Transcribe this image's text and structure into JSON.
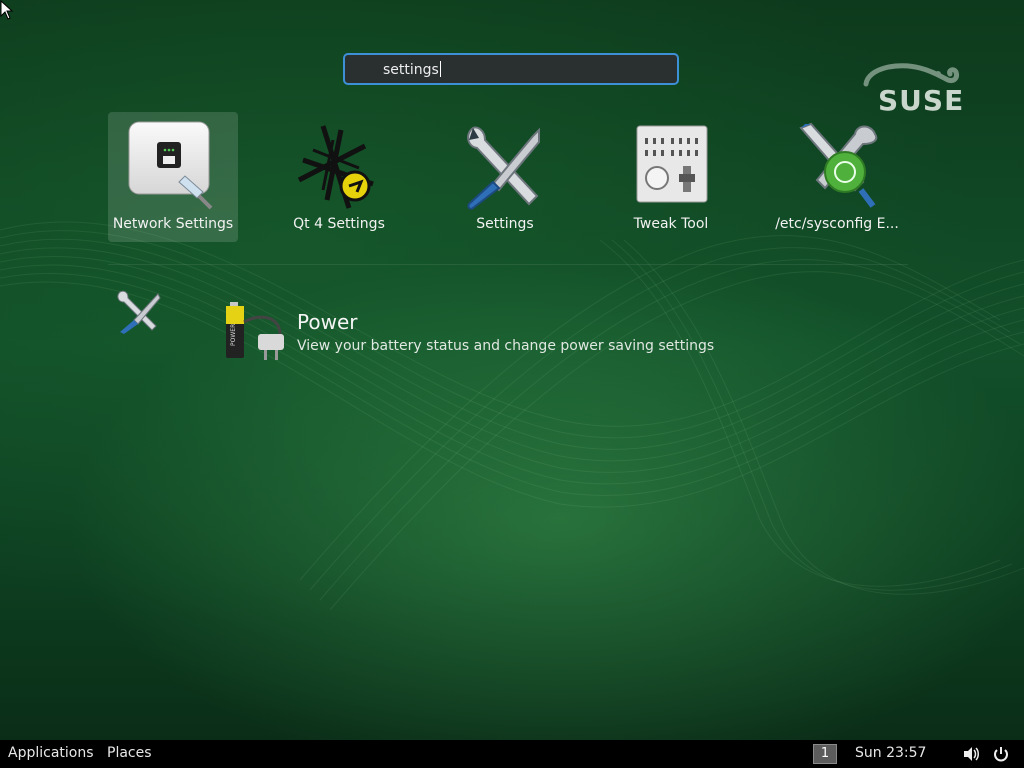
{
  "desktop": {
    "brand_logo": "SUSE",
    "search": {
      "value": "settings"
    },
    "apps": [
      {
        "label": "Network Settings",
        "icon": "network-settings-icon",
        "selected": true
      },
      {
        "label": "Qt 4 Settings",
        "icon": "qt4-settings-icon"
      },
      {
        "label": "Settings",
        "icon": "settings-tools-icon"
      },
      {
        "label": "Tweak Tool",
        "icon": "tweak-tool-icon"
      },
      {
        "label": "/etc/sysconfig E...",
        "icon": "sysconfig-editor-icon"
      }
    ],
    "search_result": {
      "provider_icon": "settings-tools-icon",
      "icon": "power-battery-icon",
      "title": "Power",
      "description": "View your battery status and change power saving settings"
    }
  },
  "taskbar": {
    "applications": "Applications",
    "places": "Places",
    "workspace": "1",
    "clock": "Sun 23:57",
    "volume_icon": "volume-icon",
    "power_icon": "power-icon"
  },
  "colors": {
    "accent": "#3d8fd6",
    "background": "#12502a",
    "panel": "#000000"
  }
}
